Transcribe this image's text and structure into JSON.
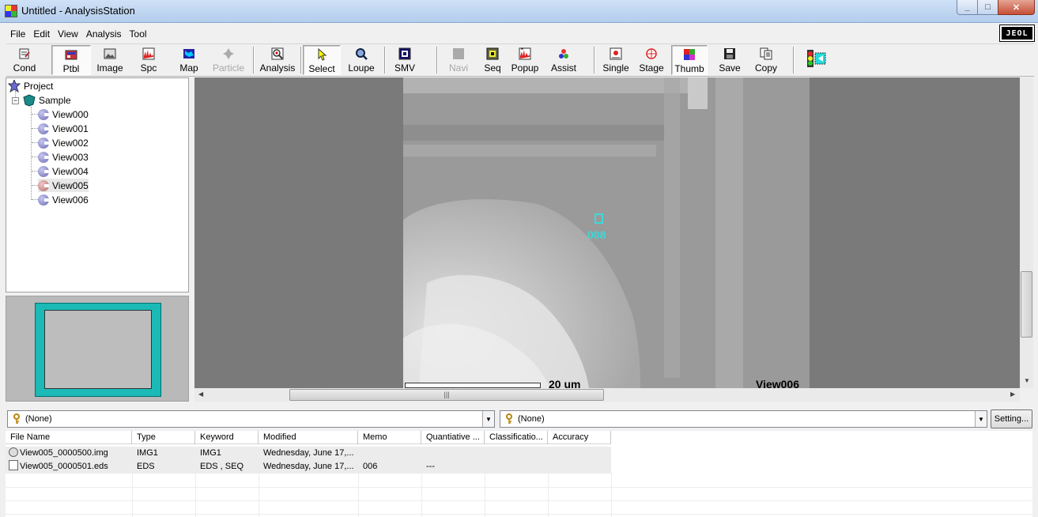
{
  "window": {
    "title": "Untitled - AnalysisStation",
    "min": "_",
    "max": "□",
    "close": "✕"
  },
  "menu": [
    "File",
    "Edit",
    "View",
    "Analysis",
    "Tool"
  ],
  "logo": "JEOL",
  "toolbar": {
    "cond": "Cond",
    "ptbl": "Ptbl",
    "image": "Image",
    "spc": "Spc",
    "map": "Map",
    "particle": "Particle",
    "analysis": "Analysis",
    "select": "Select",
    "loupe": "Loupe",
    "smv": "SMV",
    "navi": "Navi",
    "seq": "Seq",
    "popup": "Popup",
    "assist": "Assist",
    "single": "Single",
    "stage": "Stage",
    "thumb": "Thumb",
    "save": "Save",
    "copy": "Copy"
  },
  "tree": {
    "project": "Project",
    "sample": "Sample",
    "views": [
      "View000",
      "View001",
      "View002",
      "View003",
      "View004",
      "View005",
      "View006"
    ],
    "selected_index": 5
  },
  "image": {
    "marker": "008",
    "scale": "20 um",
    "view_label": "View006"
  },
  "filters": {
    "left": "(None)",
    "right": "(None)",
    "setting": "Setting..."
  },
  "file_list": {
    "columns": [
      "File Name",
      "Type",
      "Keyword",
      "Modified",
      "Memo",
      "Quantiative ...",
      "Classificatio...",
      "Accuracy"
    ],
    "rows": [
      {
        "name": "View005_0000500.img",
        "type": "IMG1",
        "keyword": "IMG1",
        "modified": "Wednesday, June 17,...",
        "memo": "",
        "quant": "",
        "class": "",
        "accuracy": ""
      },
      {
        "name": "View005_0000501.eds",
        "type": "EDS",
        "keyword": "EDS , SEQ",
        "modified": "Wednesday, June 17,...",
        "memo": "006",
        "quant": "---",
        "class": "",
        "accuracy": ""
      }
    ]
  },
  "colors": {
    "accent": "#3dd8d8",
    "overview_frame": "#1bbab6",
    "image_bg": "#7a7a7a"
  }
}
